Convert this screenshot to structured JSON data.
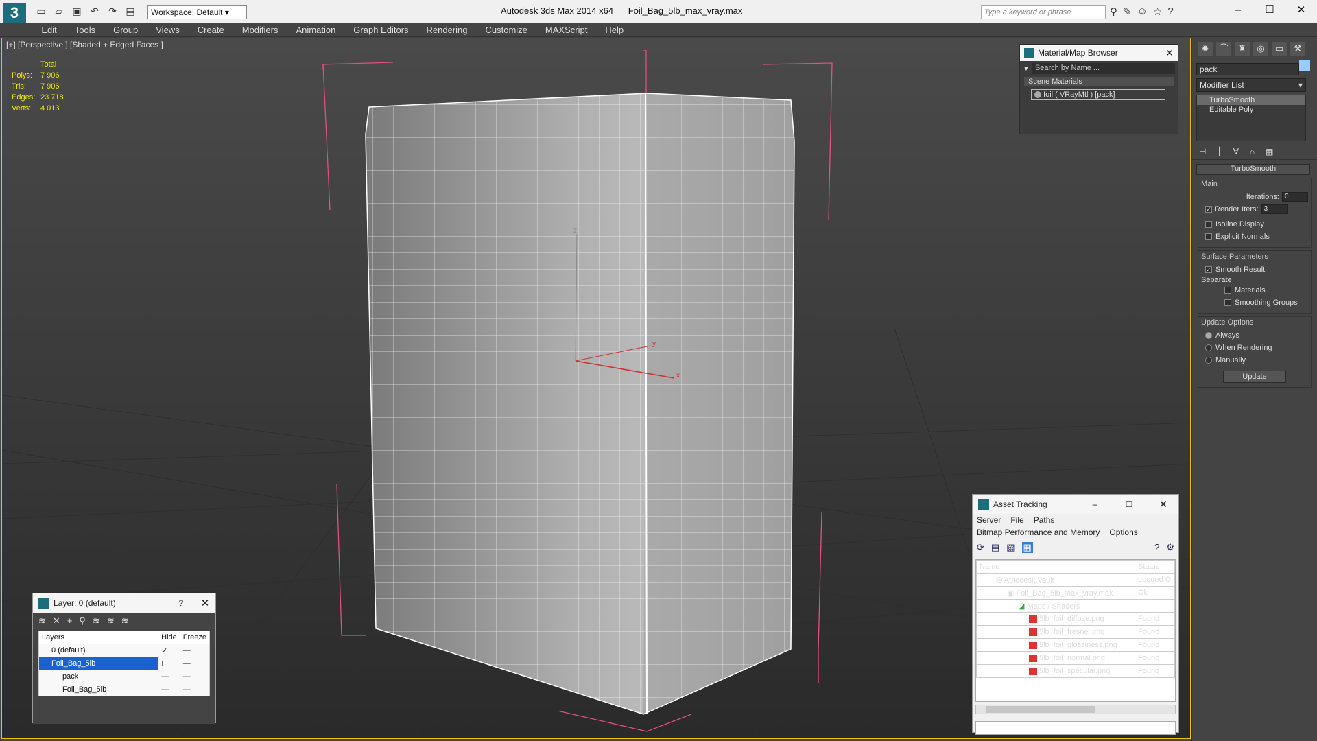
{
  "window": {
    "app_title": "Autodesk 3ds Max  2014 x64",
    "file_title": "Foil_Bag_5lb_max_vray.max",
    "workspace": "Workspace: Default",
    "search_placeholder": "Type a keyword or phrase"
  },
  "menu": [
    "Edit",
    "Tools",
    "Group",
    "Views",
    "Create",
    "Modifiers",
    "Animation",
    "Graph Editors",
    "Rendering",
    "Customize",
    "MAXScript",
    "Help"
  ],
  "viewport": {
    "label": "[+] [Perspective ] [Shaded + Edged Faces ]",
    "stats_header": "Total",
    "stats": [
      {
        "label": "Polys:",
        "value": "7 906"
      },
      {
        "label": "Tris:",
        "value": "7 906"
      },
      {
        "label": "Edges:",
        "value": "23 718"
      },
      {
        "label": "Verts:",
        "value": "4 013"
      }
    ]
  },
  "material_browser": {
    "title": "Material/Map Browser",
    "search": "Search by Name ...",
    "section": "Scene Materials",
    "item": "foil  ( VRayMtl ) [pack]"
  },
  "command_panel": {
    "object_name": "pack",
    "modifier_list": "Modifier List",
    "stack": [
      "TurboSmooth",
      "Editable Poly"
    ],
    "rollout": "TurboSmooth",
    "main_group": "Main",
    "iterations_label": "Iterations:",
    "iterations_value": "0",
    "render_iters_label": "Render Iters:",
    "render_iters_value": "3",
    "isoline": "Isoline Display",
    "explicit_normals": "Explicit Normals",
    "surface_group": "Surface Parameters",
    "smooth_result": "Smooth Result",
    "separate": "Separate",
    "materials": "Materials",
    "smoothing_groups": "Smoothing Groups",
    "update_group": "Update Options",
    "always": "Always",
    "when_rendering": "When Rendering",
    "manually": "Manually",
    "update_button": "Update"
  },
  "layer_dialog": {
    "title": "Layer: 0 (default)",
    "help": "?",
    "col_layers": "Layers",
    "col_hide": "Hide",
    "col_freeze": "Freeze",
    "rows": [
      "0 (default)",
      "Foil_Bag_5lb",
      "pack",
      "Foil_Bag_5lb"
    ]
  },
  "asset_tracking": {
    "title": "Asset Tracking",
    "menu1": [
      "Server",
      "File",
      "Paths"
    ],
    "menu2": [
      "Bitmap Performance and Memory",
      "Options"
    ],
    "col_name": "Name",
    "col_status": "Status",
    "rows": [
      {
        "name": "Autodesk Vault",
        "status": "Logged O"
      },
      {
        "name": "Foil_Bag_5lb_max_vray.max",
        "status": "Ok"
      },
      {
        "name": "Maps / Shaders",
        "status": ""
      },
      {
        "name": "5lb_foil_diffuse.png",
        "status": "Found"
      },
      {
        "name": "5lb_foil_fresnel.png",
        "status": "Found"
      },
      {
        "name": "5lb_foil_glossiness.png",
        "status": "Found"
      },
      {
        "name": "5lb_foil_normal.png",
        "status": "Found"
      },
      {
        "name": "5lb_foil_specular.png",
        "status": "Found"
      }
    ]
  }
}
